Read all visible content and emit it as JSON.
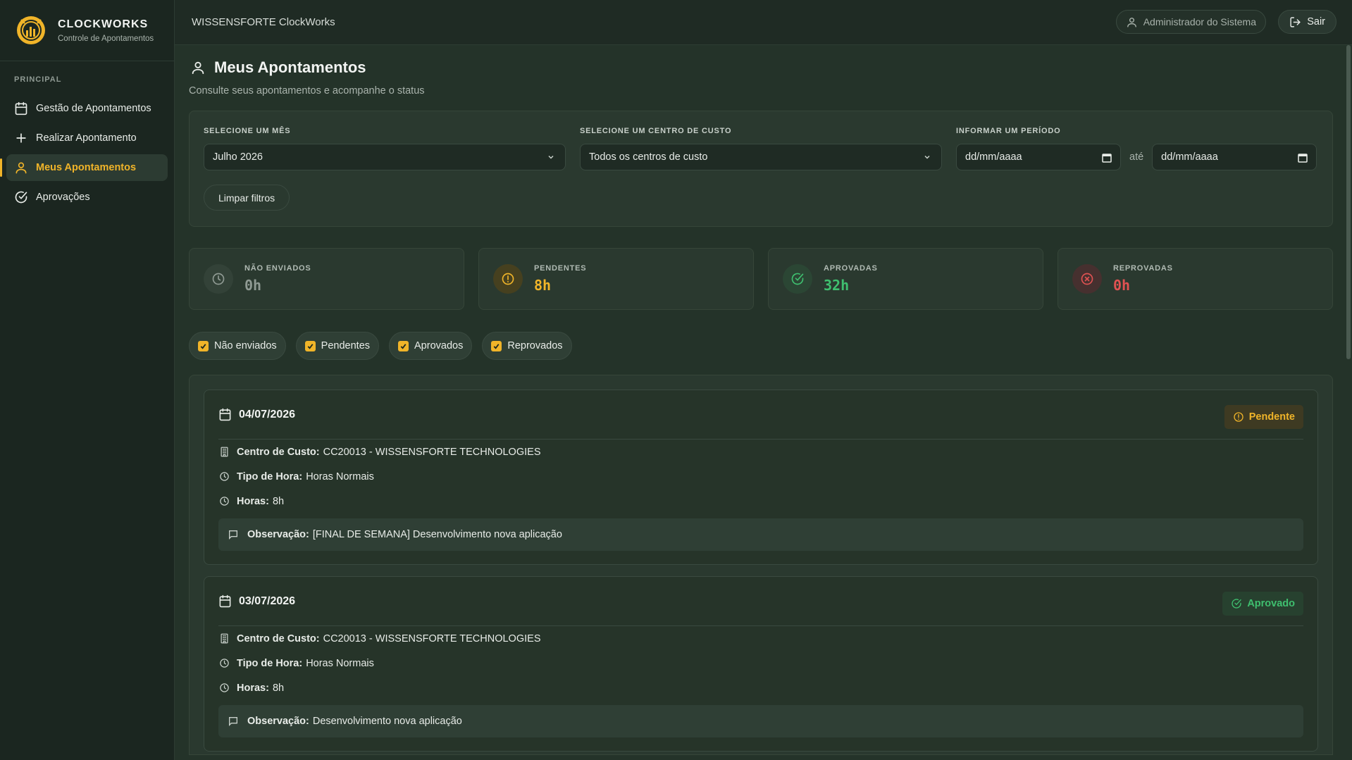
{
  "brand": {
    "title": "CLOCKWORKS",
    "subtitle": "Controle de Apontamentos"
  },
  "sidebar": {
    "section_label": "PRINCIPAL",
    "items": [
      {
        "label": "Gestão de Apontamentos",
        "icon": "calendar-icon"
      },
      {
        "label": "Realizar Apontamento",
        "icon": "plus-icon"
      },
      {
        "label": "Meus Apontamentos",
        "icon": "user-icon",
        "active": true
      },
      {
        "label": "Aprovações",
        "icon": "check-circle-icon"
      }
    ]
  },
  "topbar": {
    "title": "WISSENSFORTE ClockWorks",
    "user": "Administrador do Sistema",
    "logout": "Sair"
  },
  "page": {
    "title": "Meus Apontamentos",
    "subtitle": "Consulte seus apontamentos e acompanhe o status"
  },
  "filters": {
    "month_label": "SELECIONE UM MÊS",
    "month_value": "Julho 2026",
    "cost_center_label": "SELECIONE UM CENTRO DE CUSTO",
    "cost_center_value": "Todos os centros de custo",
    "period_label": "INFORMAR UM PERÍODO",
    "date_from_placeholder": "dd/mm/aaaa",
    "date_to_placeholder": "dd/mm/aaaa",
    "separator": "até",
    "clear_label": "Limpar filtros"
  },
  "stats": [
    {
      "label": "NÃO ENVIADOS",
      "value": "0h",
      "color": "#8f9a93"
    },
    {
      "label": "PENDENTES",
      "value": "8h",
      "color": "#f0b429"
    },
    {
      "label": "APROVADAS",
      "value": "32h",
      "color": "#3fbf6f"
    },
    {
      "label": "REPROVADAS",
      "value": "0h",
      "color": "#e05252"
    }
  ],
  "status_filters": [
    {
      "label": "Não enviados",
      "checked": true
    },
    {
      "label": "Pendentes",
      "checked": true
    },
    {
      "label": "Aprovados",
      "checked": true
    },
    {
      "label": "Reprovados",
      "checked": true
    }
  ],
  "labels": {
    "cost_center": "Centro de Custo:",
    "hour_type": "Tipo de Hora:",
    "hours": "Horas:",
    "observation": "Observação:"
  },
  "entries": [
    {
      "date": "04/07/2026",
      "status": "Pendente",
      "cost_center": "CC20013 - WISSENSFORTE TECHNOLOGIES",
      "hour_type": "Horas Normais",
      "hours": "8h",
      "observation": "[FINAL DE SEMANA] Desenvolvimento nova aplicação"
    },
    {
      "date": "03/07/2026",
      "status": "Aprovado",
      "cost_center": "CC20013 - WISSENSFORTE TECHNOLOGIES",
      "hour_type": "Horas Normais",
      "hours": "8h",
      "observation": "Desenvolvimento nova aplicação"
    }
  ]
}
